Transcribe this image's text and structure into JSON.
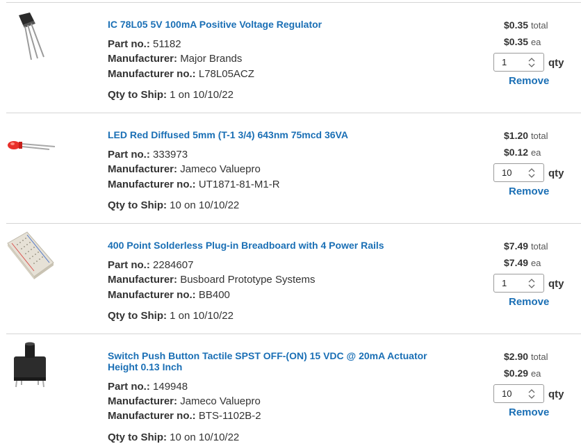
{
  "labels": {
    "part_no": "Part no.:",
    "manufacturer": "Manufacturer:",
    "manufacturer_no": "Manufacturer no.:",
    "qty_to_ship": "Qty to Ship:",
    "total": "total",
    "ea": "ea",
    "qty": "qty",
    "remove": "Remove"
  },
  "items": [
    {
      "title": "IC 78L05 5V 100mA Positive Voltage Regulator",
      "part_no": "51182",
      "manufacturer": "Major Brands",
      "manufacturer_no": "L78L05ACZ",
      "qty_to_ship": "1 on 10/10/22",
      "total": "$0.35",
      "each": "$0.35",
      "qty": "1",
      "thumbnail_icon": "voltage-regulator-icon"
    },
    {
      "title": "LED Red Diffused 5mm (T-1 3/4) 643nm 75mcd 36VA",
      "part_no": "333973",
      "manufacturer": "Jameco Valuepro",
      "manufacturer_no": "UT1871-81-M1-R",
      "qty_to_ship": "10 on 10/10/22",
      "total": "$1.20",
      "each": "$0.12",
      "qty": "10",
      "thumbnail_icon": "red-led-icon"
    },
    {
      "title": "400 Point Solderless Plug-in Breadboard with 4 Power Rails",
      "part_no": "2284607",
      "manufacturer": "Busboard Prototype Systems",
      "manufacturer_no": "BB400",
      "qty_to_ship": "1 on 10/10/22",
      "total": "$7.49",
      "each": "$7.49",
      "qty": "1",
      "thumbnail_icon": "breadboard-icon"
    },
    {
      "title": "Switch Push Button Tactile SPST OFF-(ON) 15 VDC @ 20mA Actuator Height 0.13 Inch",
      "part_no": "149948",
      "manufacturer": "Jameco Valuepro",
      "manufacturer_no": "BTS-1102B-2",
      "qty_to_ship": "10 on 10/10/22",
      "total": "$2.90",
      "each": "$0.29",
      "qty": "10",
      "thumbnail_icon": "tactile-switch-icon"
    }
  ],
  "colors": {
    "link": "#1a6fb5",
    "text": "#333333",
    "divider": "#d4d4d4"
  }
}
